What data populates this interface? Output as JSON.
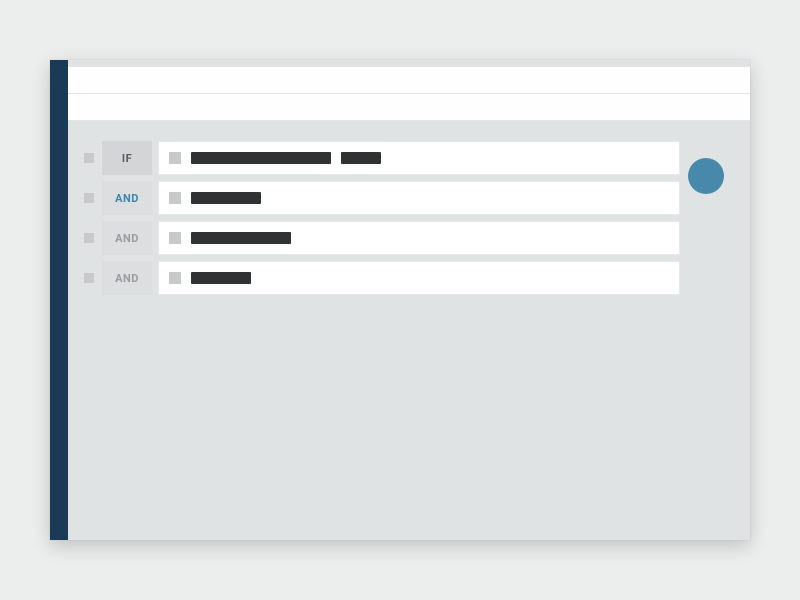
{
  "colors": {
    "stripe": "#1a3a56",
    "fab": "#4889ab",
    "panel_bg": "#e0e3e4",
    "page_bg": "#eceded"
  },
  "rules": [
    {
      "op": "IF",
      "op_style": "dark",
      "bars": [
        140,
        40
      ]
    },
    {
      "op": "AND",
      "op_style": "accent",
      "bars": [
        70
      ]
    },
    {
      "op": "AND",
      "op_style": "normal",
      "bars": [
        100
      ]
    },
    {
      "op": "AND",
      "op_style": "normal",
      "bars": [
        60
      ]
    }
  ]
}
